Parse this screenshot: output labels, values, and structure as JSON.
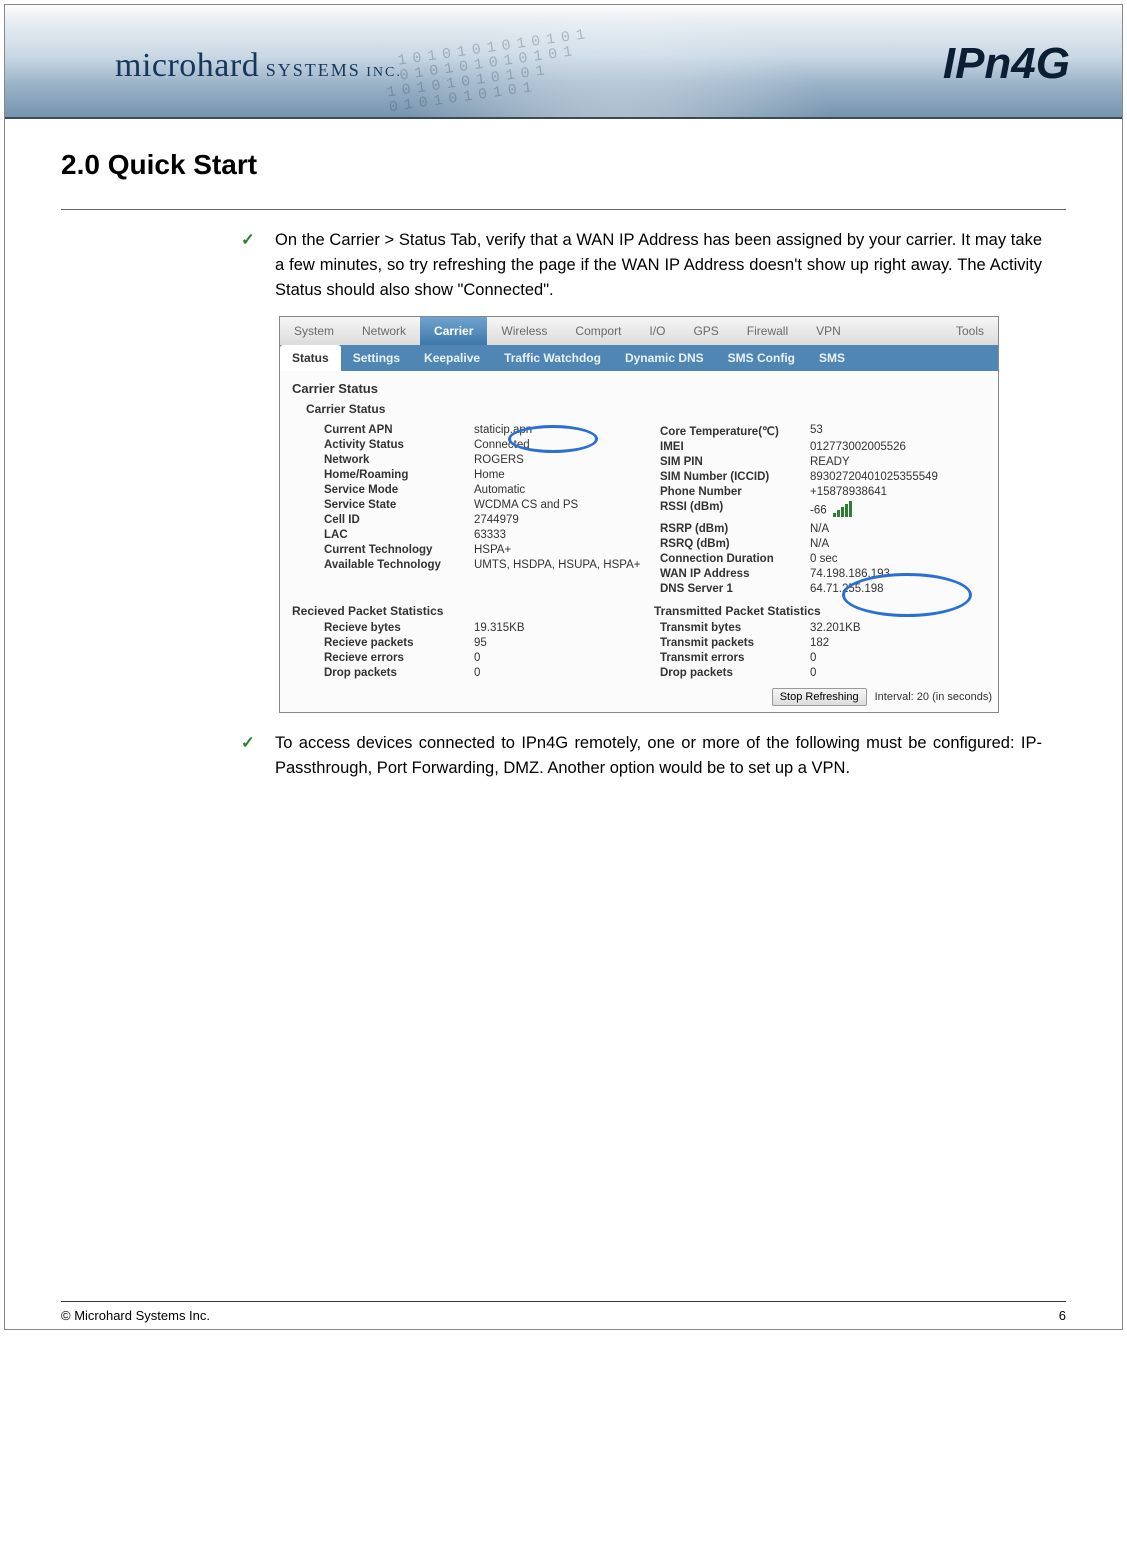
{
  "banner": {
    "brand_main": "microhard",
    "brand_caps": " SYSTEMS",
    "brand_inc": " INC.",
    "product": "IPn4G",
    "binary": " 1010101010101\n 010101010101\n10101010101\n0101010101"
  },
  "title": "2.0 Quick Start",
  "bullet1": "On the Carrier > Status Tab, verify that a WAN IP Address has been assigned by your carrier.  It may take a few minutes, so try refreshing the page if the WAN IP Address doesn't show up right away. The Activity Status should also show \"Connected\".",
  "bullet2": "To  access  devices  connected  to  IPn4G  remotely,  one  or  more  of  the  following must  be  configured:  IP-Passthrough,  Port  Forwarding,  DMZ.  Another  option would be to set up a VPN.",
  "tabs": [
    "System",
    "Network",
    "Carrier",
    "Wireless",
    "Comport",
    "I/O",
    "GPS",
    "Firewall",
    "VPN",
    "Tools"
  ],
  "tab_selected": "Carrier",
  "subtabs": [
    "Status",
    "Settings",
    "Keepalive",
    "Traffic Watchdog",
    "Dynamic DNS",
    "SMS Config",
    "SMS"
  ],
  "subtab_selected": "Status",
  "section": "Carrier Status",
  "subsection": "Carrier Status",
  "left_rows": [
    {
      "k": "Current APN",
      "v": "staticip.apn"
    },
    {
      "k": "Activity Status",
      "v": "Connected"
    },
    {
      "k": "Network",
      "v": "ROGERS"
    },
    {
      "k": "Home/Roaming",
      "v": "Home"
    },
    {
      "k": "Service Mode",
      "v": "Automatic"
    },
    {
      "k": "Service State",
      "v": "WCDMA CS and PS"
    },
    {
      "k": "Cell ID",
      "v": "2744979"
    },
    {
      "k": "LAC",
      "v": "63333"
    },
    {
      "k": "Current Technology",
      "v": "HSPA+"
    },
    {
      "k": "Available Technology",
      "v": "UMTS, HSDPA, HSUPA, HSPA+"
    }
  ],
  "right_rows": [
    {
      "k": "Core Temperature(℃)",
      "v": "53"
    },
    {
      "k": "IMEI",
      "v": "012773002005526"
    },
    {
      "k": "SIM PIN",
      "v": "READY"
    },
    {
      "k": "SIM Number (ICCID)",
      "v": "89302720401025355549"
    },
    {
      "k": "Phone Number",
      "v": "+15878938641"
    },
    {
      "k": "RSSI (dBm)",
      "v": "-66"
    },
    {
      "k": "RSRP (dBm)",
      "v": "N/A"
    },
    {
      "k": "RSRQ (dBm)",
      "v": "N/A"
    },
    {
      "k": "Connection Duration",
      "v": "0 sec"
    },
    {
      "k": "WAN IP Address",
      "v": "74.198.186.193"
    },
    {
      "k": "DNS Server 1",
      "v": "64.71.255.198"
    }
  ],
  "stats_left_hdr": "Recieved Packet Statistics",
  "stats_right_hdr": "Transmitted Packet Statistics",
  "rx_rows": [
    {
      "k": "Recieve bytes",
      "v": "19.315KB"
    },
    {
      "k": "Recieve packets",
      "v": "95"
    },
    {
      "k": "Recieve errors",
      "v": "0"
    },
    {
      "k": "Drop packets",
      "v": "0"
    }
  ],
  "tx_rows": [
    {
      "k": "Transmit bytes",
      "v": "32.201KB"
    },
    {
      "k": "Transmit packets",
      "v": "182"
    },
    {
      "k": "Transmit errors",
      "v": "0"
    },
    {
      "k": "Drop packets",
      "v": "0"
    }
  ],
  "stop_btn": "Stop Refreshing",
  "interval_txt": "Interval: 20 (in seconds)",
  "footer_left": "© Microhard Systems Inc.",
  "footer_right": "6"
}
